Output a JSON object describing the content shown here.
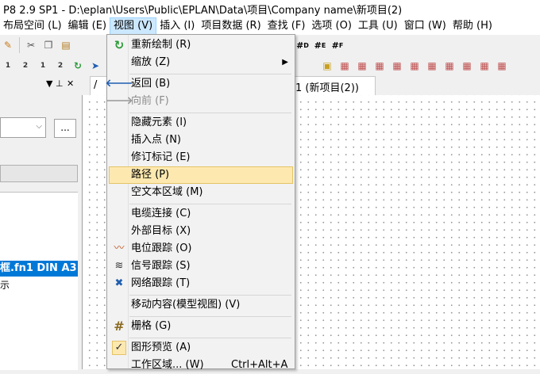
{
  "window_title": "P8 2.9 SP1 - D:\\eplan\\Users\\Public\\EPLAN\\Data\\项目\\Company name\\新项目(2)",
  "menubar": [
    {
      "label": "布局空间 (L)"
    },
    {
      "label": "编辑 (E)"
    },
    {
      "label": "视图 (V)"
    },
    {
      "label": "插入 (I)"
    },
    {
      "label": "项目数据 (R)"
    },
    {
      "label": "查找 (F)"
    },
    {
      "label": "选项 (O)"
    },
    {
      "label": "工具 (U)"
    },
    {
      "label": "窗口 (W)"
    },
    {
      "label": "帮助 (H)"
    }
  ],
  "toolbar_icons": {
    "cut": "cut-icon",
    "copy": "copy-icon",
    "paste": "paste-icon",
    "zoom_in": "zoom-in-icon",
    "zoom_out": "zoom-out-icon",
    "back": "arrow-left-icon",
    "forward": "arrow-right-icon",
    "grid_a": "A",
    "grid_b": "B",
    "grid_c": "C",
    "grid_d": "D",
    "grid_e": "E",
    "grid_f": "F",
    "zoom_100": "100"
  },
  "toolbar_counters": [
    "1",
    "2",
    "1",
    "2"
  ],
  "panel": {
    "ellipsis_label": "...",
    "selected_row": "框.fn1 DIN A3",
    "row_below": "示"
  },
  "tab": {
    "left_label": "/",
    "right_label": "1 (新项目(2))"
  },
  "view_menu": {
    "items": [
      {
        "label": "重新绘制 (R)",
        "icon": "redraw-icon"
      },
      {
        "label": "缩放 (Z)",
        "submenu": "▶"
      },
      {
        "label": "返回 (B)",
        "icon": "arrow-left-icon"
      },
      {
        "label": "向前 (F)",
        "icon": "arrow-right-icon",
        "disabled": true
      },
      {
        "label": "隐藏元素 (I)"
      },
      {
        "label": "插入点 (N)"
      },
      {
        "label": "修订标记 (E)"
      },
      {
        "label": "路径 (P)",
        "highlighted": true
      },
      {
        "label": "空文本区域 (M)"
      },
      {
        "label": "电缆连接 (C)"
      },
      {
        "label": "外部目标 (X)"
      },
      {
        "label": "电位跟踪 (O)",
        "icon": "potential-trace-icon"
      },
      {
        "label": "信号跟踪 (S)",
        "icon": "signal-trace-icon"
      },
      {
        "label": "网络跟踪 (T)",
        "icon": "network-trace-icon"
      },
      {
        "label": "移动内容(模型视图) (V)"
      },
      {
        "label": "栅格 (G)",
        "icon": "grid-icon"
      },
      {
        "label": "图形预览 (A)",
        "icon": "checkmark-icon",
        "checked": true
      },
      {
        "label": "工作区域... (W)",
        "shortcut": "Ctrl+Alt+A"
      }
    ]
  },
  "colors": {
    "menu_highlight": "#fde9b0",
    "menu_highlight_border": "#e5c365",
    "tree_selection": "#0078d7",
    "menubar_active": "#cce8ff"
  }
}
